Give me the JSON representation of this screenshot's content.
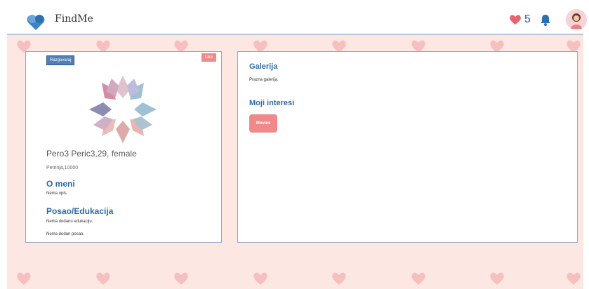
{
  "header": {
    "app_name": "FindMe",
    "likes_count": "5",
    "icons": [
      "app-logo-icon",
      "heart-icon",
      "bell-icon",
      "avatar"
    ]
  },
  "profile": {
    "chat_button": "Razgovaraj",
    "like_button": "Like",
    "name_line": "Pero3 Peric3,29, female",
    "location": "Petrinja,10000",
    "about_title": "O meni",
    "about_text": "Nema opis.",
    "work_title": "Posao/Edukacija",
    "education_text": "Nema dodanu edukaciju.",
    "job_text": "Nema dodan posao."
  },
  "gallery": {
    "title": "Galerija",
    "empty_text": "Prazna galerija.",
    "interests_title": "Moji interesi",
    "interests": [
      "Movies"
    ]
  },
  "colors": {
    "accent_blue": "#2e6aa8",
    "like_pink": "#f08a8a",
    "background_pink": "#fde7e2"
  }
}
